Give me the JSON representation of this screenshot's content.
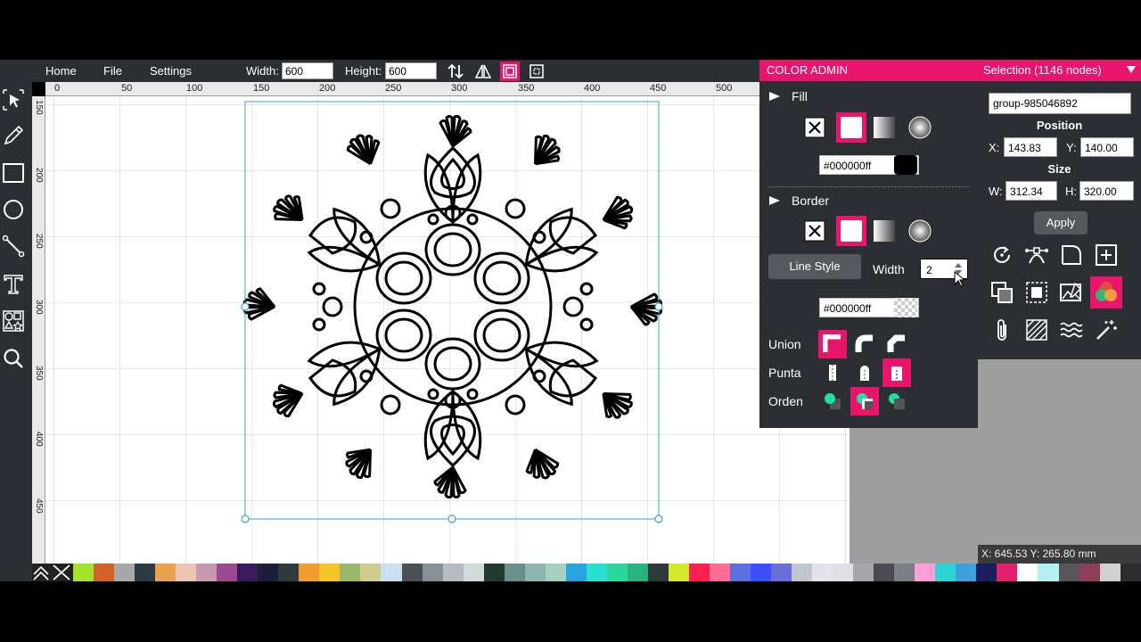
{
  "menu": {
    "home": "Home",
    "file": "File",
    "settings": "Settings"
  },
  "doc": {
    "width_label": "Width:",
    "width_value": "600",
    "height_label": "Height:",
    "height_value": "600"
  },
  "ruler_top": [
    "0",
    "50",
    "100",
    "150",
    "200",
    "250",
    "300",
    "350",
    "400",
    "450",
    "500"
  ],
  "ruler_left": [
    "150",
    "200",
    "250",
    "300",
    "350",
    "400",
    "450"
  ],
  "color_admin": {
    "title": "COLOR ADMIN",
    "fill_label": "Fill",
    "fill_hex": "#000000ff",
    "border_label": "Border",
    "border_hex": "#000000ff",
    "line_style_label": "Line Style",
    "width_label": "Width",
    "width_value": "2",
    "union_label": "Union",
    "punta_label": "Punta",
    "orden_label": "Orden"
  },
  "selection": {
    "title": "Selection (1146 nodes)",
    "name": "group-985046892",
    "position_label": "Position",
    "x_label": "X:",
    "x_value": "143.83",
    "y_label": "Y:",
    "y_value": "140.00",
    "size_label": "Size",
    "w_label": "W:",
    "w_value": "312.34",
    "h_label": "H:",
    "h_value": "320.00",
    "apply_label": "Apply"
  },
  "status": {
    "coords": "X: 645.53 Y: 265.80 mm"
  },
  "colors": {
    "accent": "#e9146b",
    "panel": "#2b2f33",
    "palette": [
      "#a5e22b",
      "#d1622c",
      "#a8a8a8",
      "#2c3b40",
      "#e8a24e",
      "#efc3b4",
      "#c79aaf",
      "#9c4a8f",
      "#3a1a5e",
      "#1d1e3c",
      "#2f3a3c",
      "#f19c2c",
      "#f7c525",
      "#9ab66c",
      "#d0cb8f",
      "#c8e0f0",
      "#4d4f57",
      "#8a8f98",
      "#b7bcc0",
      "#d6d9dc",
      "#1f3a2f",
      "#6a8f89",
      "#8eb5b0",
      "#a6cfbf",
      "#2aa4e0",
      "#2ae0d0",
      "#2ad89c",
      "#27b27f",
      "#2e3a3a",
      "#d4e82c",
      "#ff1f4e",
      "#ff6c94",
      "#5c6fe0",
      "#3a50ff",
      "#6d6dd9",
      "#c0c6d0",
      "#e2e4ea",
      "#dfe0e3",
      "#a5a7ab",
      "#494b51",
      "#7c7e85",
      "#ff9ed8",
      "#2ed4d4",
      "#3fa0e0",
      "#1b1e5c",
      "#e2206b",
      "#ffffff",
      "#b4f0ef",
      "#58545c",
      "#8b3f59",
      "#d1d1d1",
      "#2a2b2e"
    ]
  }
}
